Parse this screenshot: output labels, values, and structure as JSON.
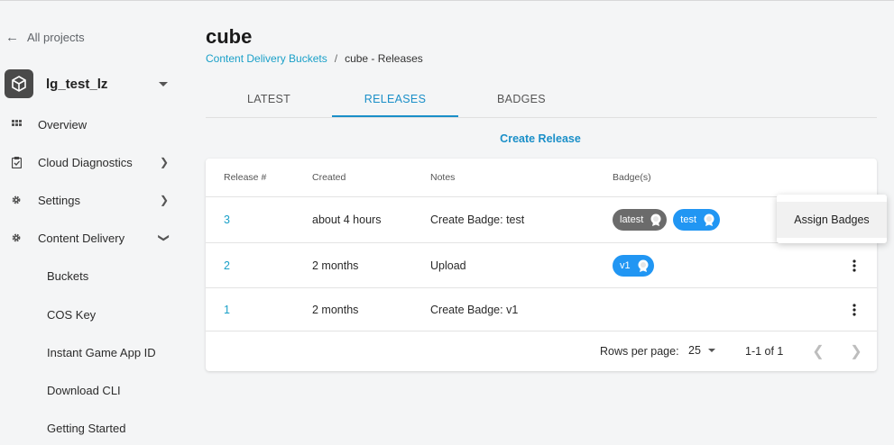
{
  "sidebar": {
    "back_label": "All projects",
    "project_name": "lg_test_lz",
    "items": [
      {
        "label": "Overview",
        "icon": "grid-icon"
      },
      {
        "label": "Cloud Diagnostics",
        "icon": "clipboard-icon"
      },
      {
        "label": "Settings",
        "icon": "gear-icon"
      },
      {
        "label": "Content Delivery",
        "icon": "gear-icon"
      }
    ],
    "sub_items": [
      "Buckets",
      "COS Key",
      "Instant Game App ID",
      "Download CLI",
      "Getting Started"
    ]
  },
  "page": {
    "title": "cube",
    "breadcrumb_link": "Content Delivery Buckets",
    "breadcrumb_sep": "/",
    "breadcrumb_current": "cube - Releases"
  },
  "tabs": [
    {
      "label": "LATEST"
    },
    {
      "label": "RELEASES",
      "active": true
    },
    {
      "label": "BADGES"
    }
  ],
  "create_release_label": "Create Release",
  "table": {
    "headers": [
      "Release #",
      "Created",
      "Notes",
      "Badge(s)"
    ],
    "rows": [
      {
        "release": "3",
        "created": "about 4 hours",
        "notes": "Create Badge: test",
        "badges": [
          "latest",
          "test"
        ]
      },
      {
        "release": "2",
        "created": "2 months",
        "notes": "Upload",
        "badges": [
          "v1"
        ]
      },
      {
        "release": "1",
        "created": "2 months",
        "notes": "Create Badge: v1",
        "badges": []
      }
    ]
  },
  "badge_colors": {
    "latest": "#6b6b6b",
    "test": "#2196f3",
    "v1": "#2196f3"
  },
  "pagination": {
    "rows_per_page_label": "Rows per page:",
    "rows_per_page": "25",
    "range": "1-1 of 1"
  },
  "context_menu": {
    "item": "Assign Badges"
  },
  "colors": {
    "accent": "#1a8fc8",
    "link": "#1aa0c8"
  }
}
